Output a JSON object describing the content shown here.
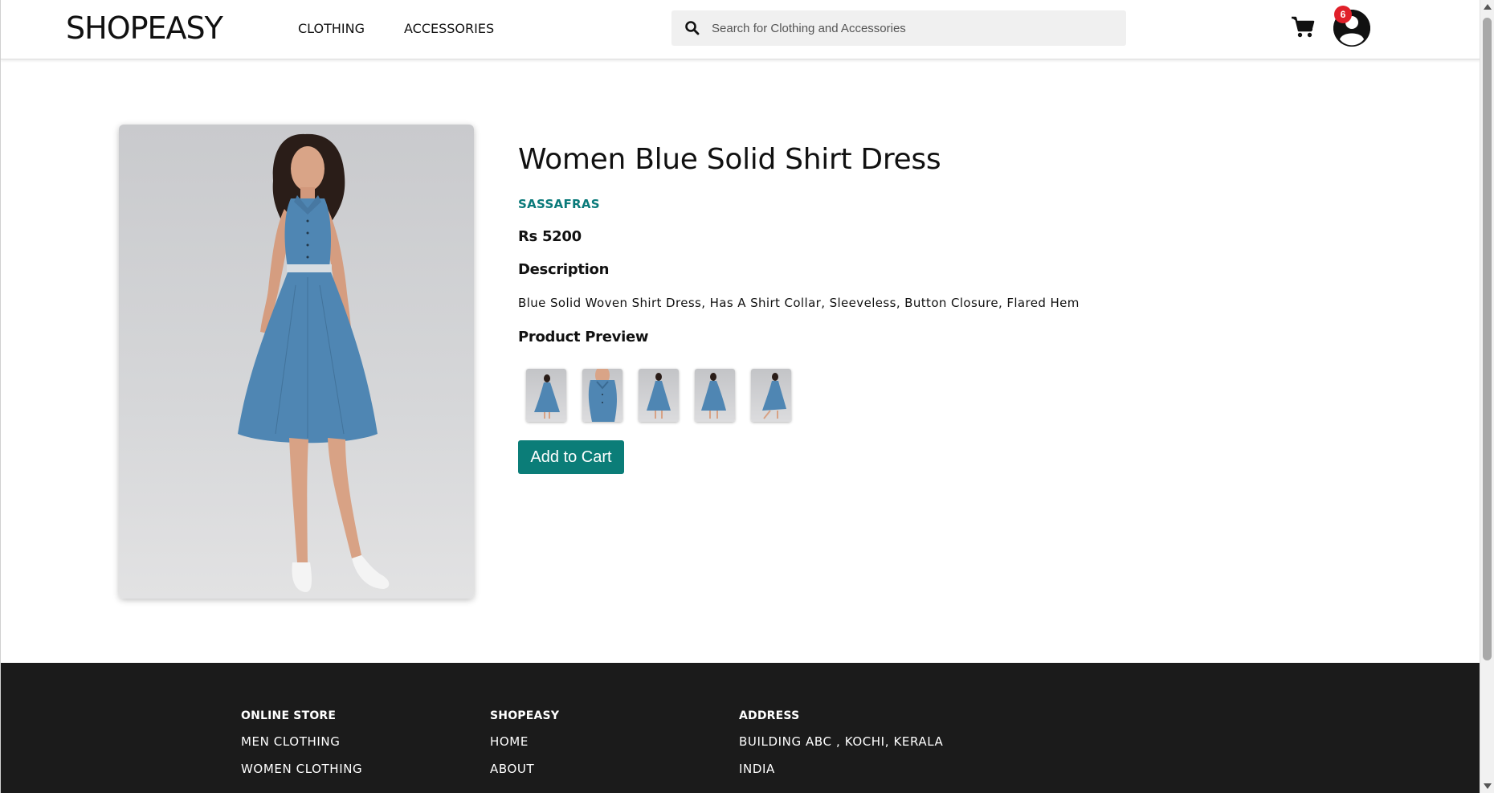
{
  "header": {
    "logo_bold": "SHOP",
    "logo_light": "EASY",
    "nav": [
      "CLOTHING",
      "ACCESSORIES"
    ],
    "search_placeholder": "Search for Clothing and Accessories",
    "cart_badge": "6",
    "icons": {
      "search": "search-icon",
      "cart": "cart-icon",
      "user": "user-icon"
    },
    "badge_color": "#e0202a"
  },
  "product": {
    "title": "Women Blue Solid Shirt Dress",
    "brand": "SASSAFRAS",
    "price": "Rs 5200",
    "description_heading": "Description",
    "description": "Blue Solid Woven Shirt Dress, Has A Shirt Collar, Sleeveless, Button Closure, Flared Hem",
    "preview_heading": "Product Preview",
    "preview_count": 5,
    "add_to_cart_label": "Add to Cart",
    "accent_color": "#0b7d78",
    "dress_color": "#4f86b3"
  },
  "footer": {
    "online_store": {
      "heading": "ONLINE STORE",
      "links": [
        "MEN CLOTHING",
        "WOMEN CLOTHING"
      ]
    },
    "shopeasy": {
      "heading": "SHOPEASY",
      "links": [
        "HOME",
        "ABOUT"
      ]
    },
    "address": {
      "heading": "ADDRESS",
      "lines": [
        "BUILDING ABC , KOCHI, KERALA",
        "INDIA"
      ]
    },
    "background": "#1b1b1b"
  }
}
